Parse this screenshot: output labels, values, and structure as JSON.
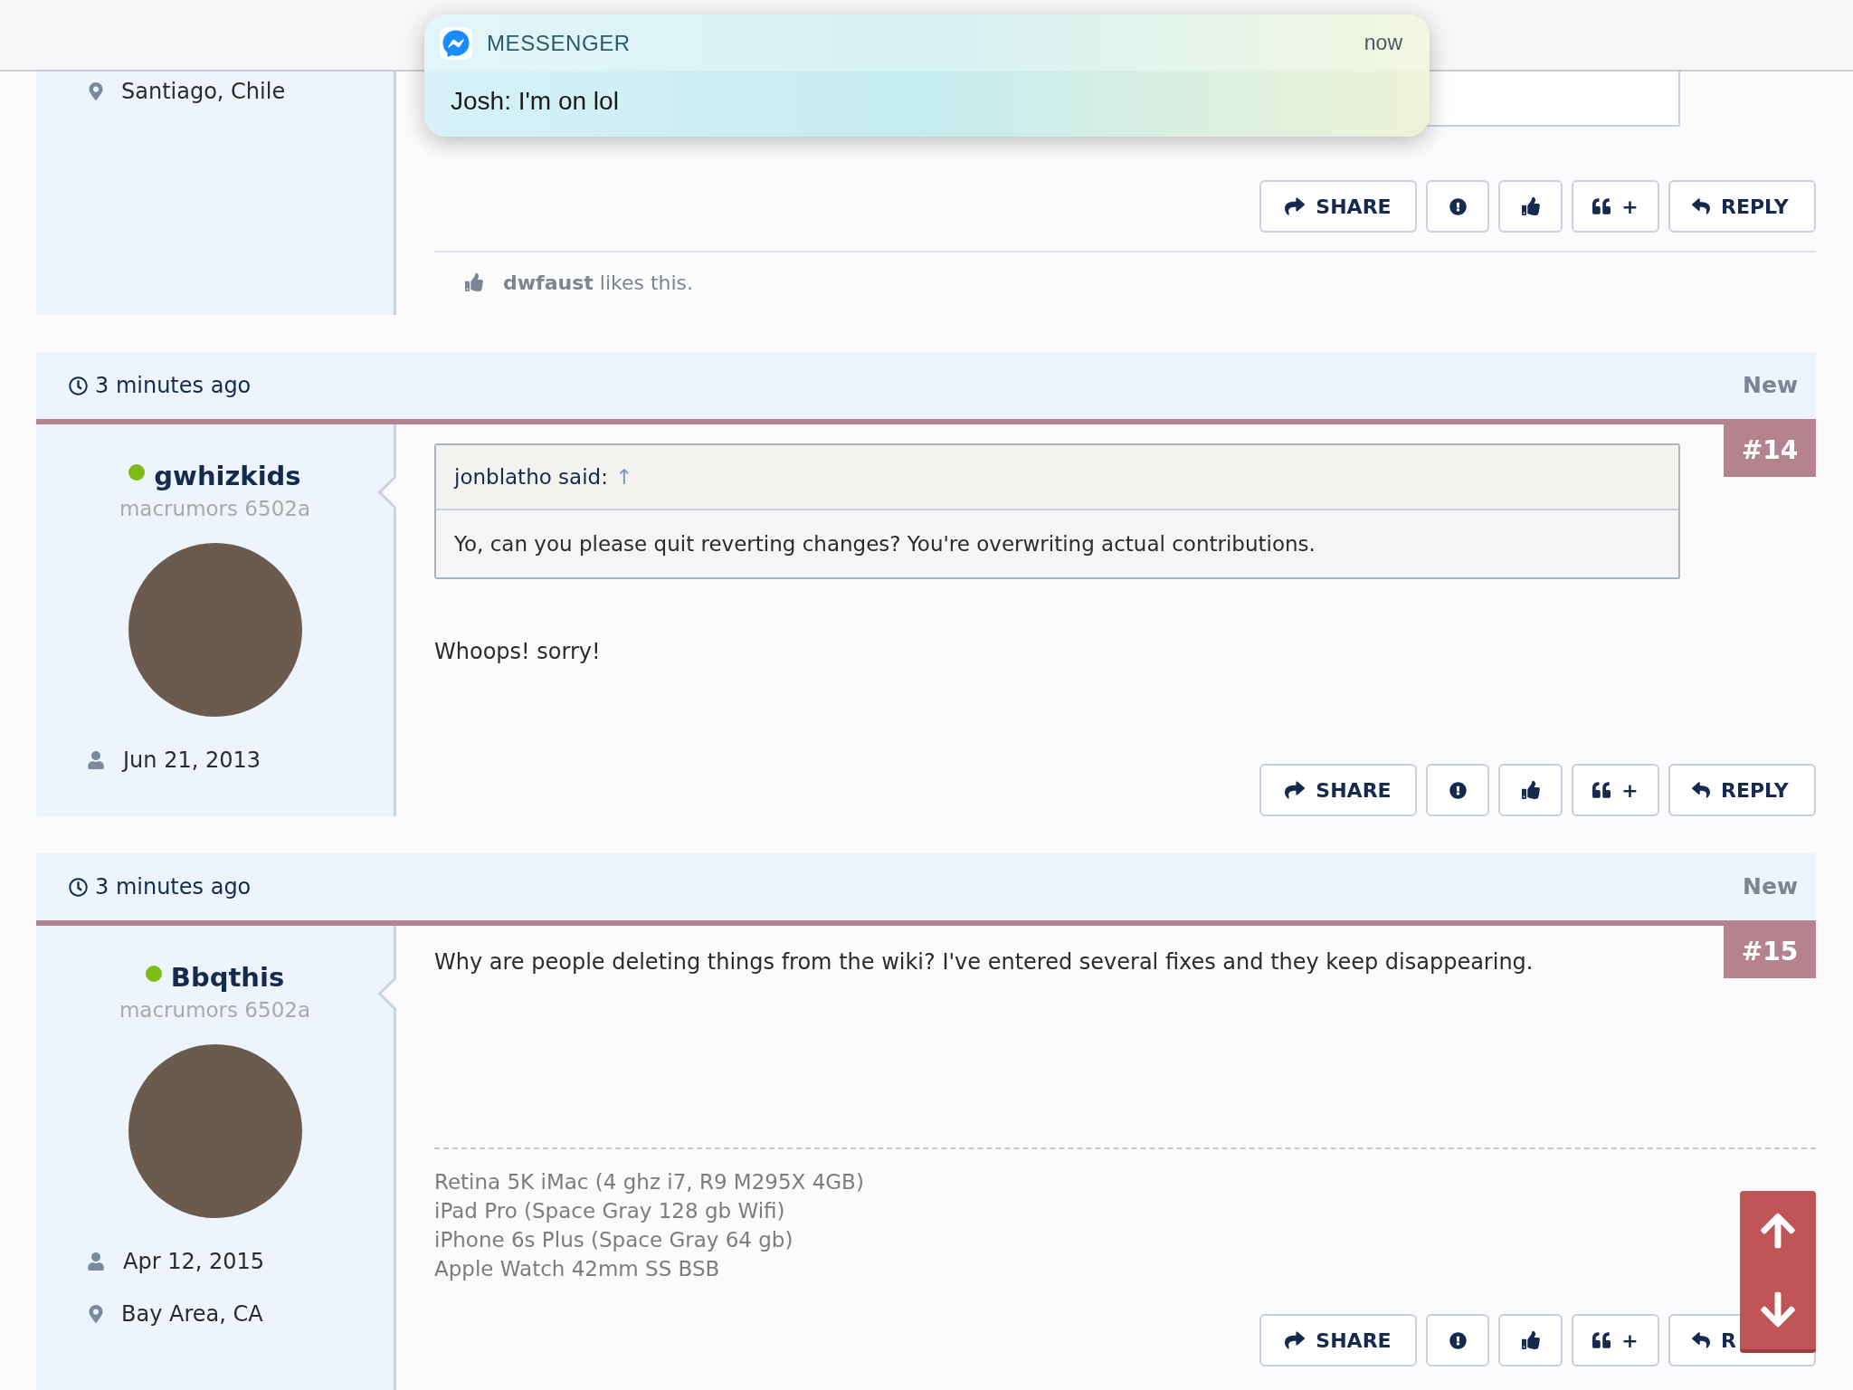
{
  "notification": {
    "app": "MESSENGER",
    "time": "now",
    "message": "Josh: I'm on lol"
  },
  "posts": [
    {
      "kind": "continued",
      "author": {
        "location": "Santiago, Chile"
      },
      "actions": [
        {
          "kind": "share",
          "label": "SHARE"
        },
        {
          "kind": "report"
        },
        {
          "kind": "like"
        },
        {
          "kind": "quote",
          "label": "+"
        },
        {
          "kind": "reply",
          "label": "REPLY"
        }
      ],
      "likes": {
        "user": "dwfaust",
        "text": "likes this."
      }
    },
    {
      "kind": "full",
      "time": "3 minutes ago",
      "badge": "New",
      "number": "#14",
      "author": {
        "name": "gwhizkids",
        "online": true,
        "rank": "macrumors 6502a",
        "joined": "Jun 21, 2013"
      },
      "quote": {
        "author": "jonblatho said:",
        "arrow": "↑",
        "text": "Yo, can you please quit reverting changes? You're overwriting actual contributions."
      },
      "body": "Whoops! sorry!",
      "actions": [
        {
          "kind": "share",
          "label": "SHARE"
        },
        {
          "kind": "report"
        },
        {
          "kind": "like"
        },
        {
          "kind": "quote",
          "label": "+"
        },
        {
          "kind": "reply",
          "label": "REPLY"
        }
      ]
    },
    {
      "kind": "full",
      "time": "3 minutes ago",
      "badge": "New",
      "number": "#15",
      "author": {
        "name": "Bbqthis",
        "online": true,
        "rank": "macrumors 6502a",
        "joined": "Apr 12, 2015",
        "location": "Bay Area, CA"
      },
      "body": "Why are people deleting things from the wiki? I've entered several fixes and they keep disappearing.",
      "signature": [
        "Retina 5K iMac (4 ghz i7, R9 M295X 4GB)",
        "iPad Pro (Space Gray 128 gb Wifi)",
        "iPhone 6s Plus (Space Gray 64 gb)",
        "Apple Watch 42mm SS BSB"
      ],
      "actions": [
        {
          "kind": "share",
          "label": "SHARE"
        },
        {
          "kind": "report"
        },
        {
          "kind": "like"
        },
        {
          "kind": "quote",
          "label": "+"
        },
        {
          "kind": "reply",
          "label": "R"
        }
      ]
    }
  ]
}
